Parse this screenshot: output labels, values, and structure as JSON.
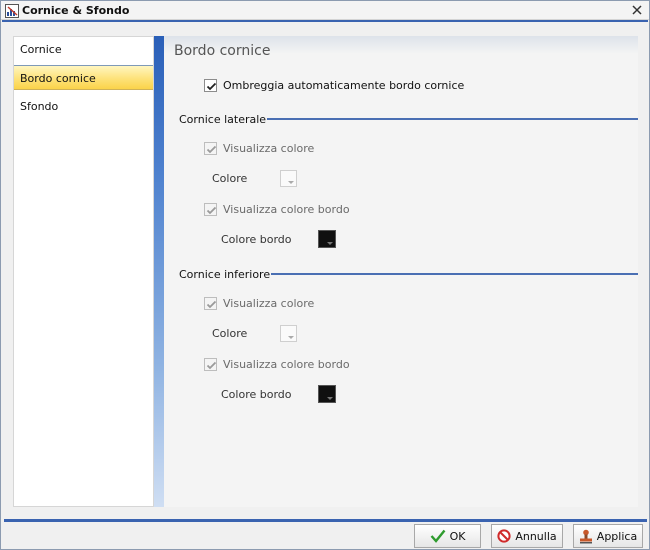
{
  "window": {
    "title": "Cornice & Sfondo"
  },
  "nav": {
    "items": [
      {
        "label": "Cornice",
        "active": false
      },
      {
        "label": "Bordo cornice",
        "active": true
      },
      {
        "label": "Sfondo",
        "active": false
      }
    ]
  },
  "panel": {
    "title": "Bordo cornice",
    "auto_shadow": {
      "label": "Ombreggia automaticamente bordo cornice",
      "checked": true
    },
    "side_frame": {
      "title": "Cornice laterale",
      "show_color": {
        "label": "Visualizza colore",
        "checked": true,
        "enabled": false
      },
      "color_label": "Colore",
      "show_border_color": {
        "label": "Visualizza colore bordo",
        "checked": true,
        "enabled": false
      },
      "border_color_label": "Colore bordo",
      "border_color": "#101010"
    },
    "bottom_frame": {
      "title": "Cornice inferiore",
      "show_color": {
        "label": "Visualizza colore",
        "checked": true,
        "enabled": false
      },
      "color_label": "Colore",
      "show_border_color": {
        "label": "Visualizza colore bordo",
        "checked": true,
        "enabled": false
      },
      "border_color_label": "Colore bordo",
      "border_color": "#101010"
    }
  },
  "buttons": {
    "ok": "OK",
    "cancel": "Annulla",
    "apply": "Applica"
  },
  "icons": {
    "app": "chart-edit-icon",
    "close": "close-icon",
    "ok": "checkmark-icon",
    "cancel": "no-entry-icon",
    "apply": "stamp-icon"
  },
  "colors": {
    "accent": "#3a63b0",
    "active_nav": "#fde27a"
  }
}
